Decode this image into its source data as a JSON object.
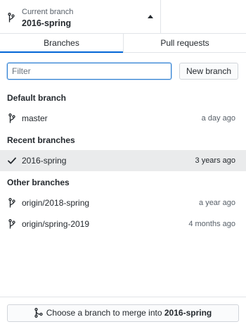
{
  "header": {
    "caption": "Current branch",
    "branch": "2016-spring",
    "icon": "git-branch-icon",
    "caret_icon": "caret-up-icon"
  },
  "tabs": [
    {
      "label": "Branches",
      "active": true
    },
    {
      "label": "Pull requests",
      "active": false
    }
  ],
  "filter": {
    "placeholder": "Filter",
    "value": ""
  },
  "new_branch_label": "New branch",
  "sections": {
    "default": {
      "title": "Default branch",
      "items": [
        {
          "name": "master",
          "time": "a day ago",
          "icon": "git-branch-icon"
        }
      ]
    },
    "recent": {
      "title": "Recent branches",
      "items": [
        {
          "name": "2016-spring",
          "time": "3 years ago",
          "icon": "check-icon",
          "selected": true
        }
      ]
    },
    "other": {
      "title": "Other branches",
      "items": [
        {
          "name": "origin/2018-spring",
          "time": "a year ago",
          "icon": "git-branch-icon"
        },
        {
          "name": "origin/spring-2019",
          "time": "4 months ago",
          "icon": "git-branch-icon"
        }
      ]
    }
  },
  "merge": {
    "prefix": "Choose a branch to merge into ",
    "branch": "2016-spring",
    "icon": "git-merge-icon"
  },
  "colors": {
    "accent": "#0366d6",
    "selected_row": "#eaebec",
    "muted_text": "#586069"
  }
}
